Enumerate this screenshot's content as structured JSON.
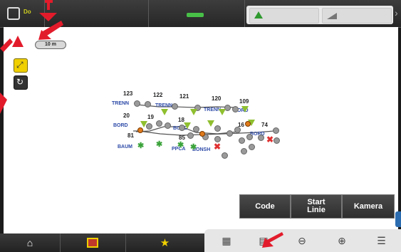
{
  "topbar": {
    "logo_text": "Do",
    "status_color": "#48c048"
  },
  "map": {
    "scale_label": "10 m",
    "points": [
      {
        "id": "123",
        "label": "123"
      },
      {
        "id": "122",
        "label": "122"
      },
      {
        "id": "121",
        "label": "121"
      },
      {
        "id": "120",
        "label": "120"
      },
      {
        "id": "109",
        "label": "109"
      },
      {
        "id": "20",
        "label": "20"
      },
      {
        "id": "19",
        "label": "19"
      },
      {
        "id": "18",
        "label": "18"
      },
      {
        "id": "16",
        "label": "16"
      },
      {
        "id": "74",
        "label": "74"
      },
      {
        "id": "81",
        "label": "81"
      },
      {
        "id": "85",
        "label": "85"
      }
    ],
    "codes": [
      "TRENN",
      "TRENN",
      "TRENN",
      "BORD",
      "BORD",
      "BAUM",
      "PPCA",
      "BONSH",
      "BORD",
      "BORD"
    ]
  },
  "actions": {
    "code_label": "Code",
    "start_line_label": "Start Linie",
    "camera_label": "Kamera"
  },
  "bottom_nav": {
    "home_icon": "home-icon",
    "survey_icon": "survey-icon",
    "favorites_icon": "star-icon"
  },
  "tools": {
    "items": [
      "table-icon",
      "calculator-icon",
      "zoom-out-icon",
      "zoom-in-icon",
      "layers-icon"
    ]
  },
  "colors": {
    "arrow": "#e21b2b",
    "code_text": "#2d4aa8",
    "triangle": "#8fbf2f",
    "tree": "#3aa33a"
  }
}
